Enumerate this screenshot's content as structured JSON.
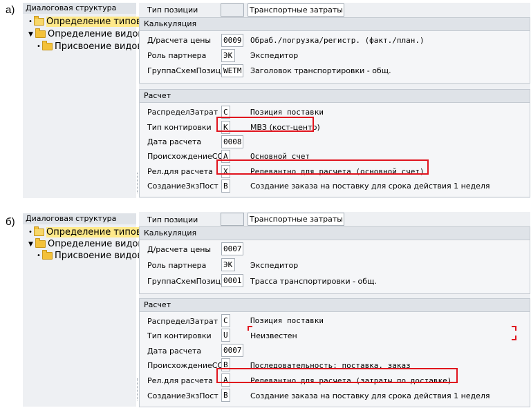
{
  "panels": [
    {
      "label": "а)",
      "tree": {
        "header": "Диалоговая структура",
        "items": [
          {
            "label": "Определение типов",
            "selected": true,
            "icon": "folder-open-icon"
          },
          {
            "label": "Определение видов",
            "icon": "folder-icon"
          },
          {
            "label": "Присвоение видов",
            "icon": "folder-icon"
          }
        ]
      },
      "position_type": {
        "label": "Тип позиции",
        "value": "",
        "description": "Транспортные затраты"
      },
      "calculation": {
        "title": "Калькуляция",
        "rows": [
          {
            "label": "Д/расчета цены",
            "value": "0009",
            "description": "Обраб./погрузка/регистр. (факт./план.)",
            "mono": true
          },
          {
            "label": "Роль партнера",
            "value": "ЭК",
            "description": "Экспедитор"
          },
          {
            "label": "ГруппаСхемПозиц",
            "value": "WETM",
            "description": "Заголовок транспортировки - общ."
          }
        ]
      },
      "settlement": {
        "title": "Расчет",
        "rows": [
          {
            "label": "РаспределЗатрат",
            "value": "C",
            "description": "Позиция поставки",
            "mono": true
          },
          {
            "label": "Тип контировки",
            "value": "K",
            "description": "МВЗ (кост-центр)"
          },
          {
            "label": "Дата расчета",
            "value": "0008",
            "description": ""
          },
          {
            "label": "ПроисхождениеСО",
            "value": "A",
            "description": "Основной счет",
            "mono": true
          },
          {
            "label": "Рел.для расчета",
            "value": "X",
            "description": "Релевантно для расчета (основной счет)",
            "mono": true
          },
          {
            "label": "СозданиеЗкзПост",
            "value": "B",
            "description": "Создание заказа на поставку для срока действия 1 неделя"
          }
        ]
      }
    },
    {
      "label": "б)",
      "tree": {
        "header": "Диалоговая структура",
        "items": [
          {
            "label": "Определение типов",
            "selected": true,
            "icon": "folder-open-icon"
          },
          {
            "label": "Определение видов",
            "icon": "folder-icon"
          },
          {
            "label": "Присвоение видов",
            "icon": "folder-icon"
          }
        ]
      },
      "position_type": {
        "label": "Тип позиции",
        "value": "",
        "description": "Транспортные затраты"
      },
      "calculation": {
        "title": "Калькуляция",
        "rows": [
          {
            "label": "Д/расчета цены",
            "value": "0007",
            "description": ""
          },
          {
            "label": "Роль партнера",
            "value": "ЭК",
            "description": "Экспедитор"
          },
          {
            "label": "ГруппаСхемПозиц",
            "value": "0001",
            "description": "Трасса транспортировки - общ."
          }
        ]
      },
      "settlement": {
        "title": "Расчет",
        "rows": [
          {
            "label": "РаспределЗатрат",
            "value": "C",
            "description": "Позиция поставки",
            "mono": true
          },
          {
            "label": "Тип контировки",
            "value": "U",
            "description": "Неизвестен"
          },
          {
            "label": "Дата расчета",
            "value": "0007",
            "description": ""
          },
          {
            "label": "ПроисхождениеСО",
            "value": "B",
            "description": "Последовательность: поставка, заказ",
            "mono": true
          },
          {
            "label": "Рел.для расчета",
            "value": "A",
            "description": "Релевантно для расчета (затраты по доставке)",
            "mono": true
          },
          {
            "label": "СозданиеЗкзПост",
            "value": "B",
            "description": "Создание заказа на поставку для срока действия 1 неделя"
          }
        ]
      }
    }
  ],
  "colors": {
    "highlight": "#e0141e",
    "selected_bg": "#ffe98a",
    "panel_bg": "#eef0f3"
  }
}
